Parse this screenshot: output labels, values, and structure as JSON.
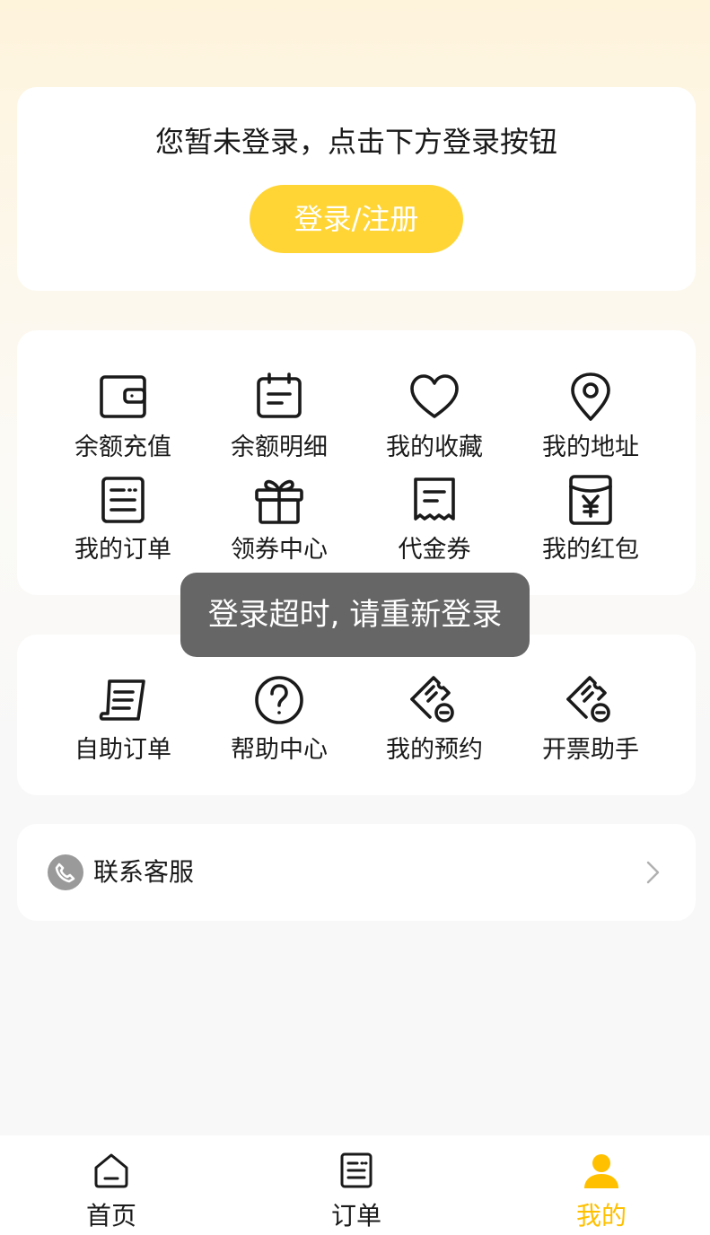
{
  "login": {
    "hint": "您暂未登录，点击下方登录按钮",
    "button_label": "登录/注册"
  },
  "services": {
    "items": [
      {
        "label": "余额充值",
        "icon": "wallet-icon"
      },
      {
        "label": "余额明细",
        "icon": "calendar-list-icon"
      },
      {
        "label": "我的收藏",
        "icon": "heart-icon"
      },
      {
        "label": "我的地址",
        "icon": "location-pin-icon"
      },
      {
        "label": "我的订单",
        "icon": "order-list-icon"
      },
      {
        "label": "领券中心",
        "icon": "gift-icon"
      },
      {
        "label": "代金券",
        "icon": "receipt-icon"
      },
      {
        "label": "我的红包",
        "icon": "red-envelope-icon"
      }
    ]
  },
  "tools": {
    "items": [
      {
        "label": "自助订单",
        "icon": "scroll-icon"
      },
      {
        "label": "帮助中心",
        "icon": "question-circle-icon"
      },
      {
        "label": "我的预约",
        "icon": "ticket-icon"
      },
      {
        "label": "开票助手",
        "icon": "invoice-ticket-icon"
      }
    ]
  },
  "contact": {
    "label": "联系客服",
    "icon": "phone-icon"
  },
  "toast": {
    "message": "登录超时, 请重新登录"
  },
  "tabbar": {
    "tabs": [
      {
        "label": "首页",
        "icon": "home-icon"
      },
      {
        "label": "订单",
        "icon": "order-icon"
      },
      {
        "label": "我的",
        "icon": "user-icon",
        "active": true
      }
    ]
  },
  "colors": {
    "accent": "#FFD535",
    "active_tab": "#FFC000",
    "toast_bg": "#5A5A5A"
  }
}
